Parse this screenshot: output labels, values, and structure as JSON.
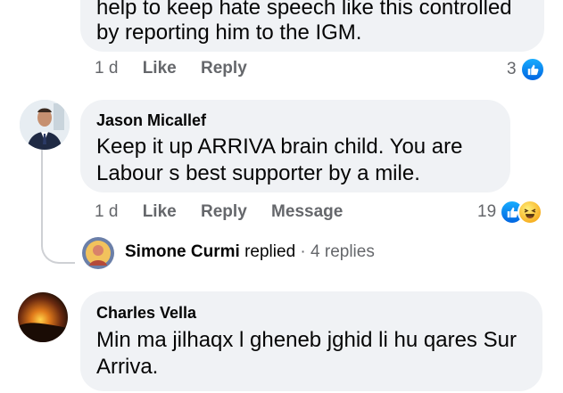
{
  "comment_top": {
    "body_partial": "help to keep hate speech like this controlled by reporting him to the IGM.",
    "line1": "help to keep hate speech like this controlled",
    "line2": "by reporting him to the IGM.",
    "timestamp": "1 d",
    "like_label": "Like",
    "reply_label": "Reply",
    "reaction_count": "3",
    "reactions": [
      "like-icon"
    ]
  },
  "comment_jason": {
    "author": "Jason Micallef",
    "line1": "Keep it up ARRIVA brain child. You are",
    "line2": "Labour s best supporter by a mile.",
    "timestamp": "1 d",
    "like_label": "Like",
    "reply_label": "Reply",
    "message_label": "Message",
    "reaction_count": "19",
    "reactions": [
      "like-icon",
      "haha-icon"
    ],
    "replies": {
      "name": "Simone Curmi",
      "verb": "replied",
      "separator": "·",
      "count": "4 replies"
    }
  },
  "comment_charles": {
    "author": "Charles Vella",
    "line1": "Min ma jilhaqx l gheneb jghid li hu qares Sur",
    "line2": "Arriva."
  },
  "colors": {
    "bubble": "#f0f2f5",
    "secondary_text": "#65676b",
    "like_blue": "#0866ff",
    "thread_line": "#ced0d4"
  }
}
